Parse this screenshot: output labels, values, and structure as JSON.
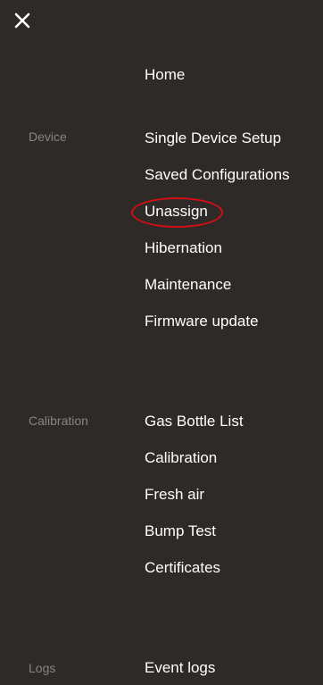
{
  "icons": {
    "close": "close-icon"
  },
  "colors": {
    "background": "#2e2a27",
    "menu_text": "#ffffff",
    "section_label": "#8a8481",
    "highlight": "#d40e14"
  },
  "menu": {
    "home": "Home",
    "device": {
      "label": "Device",
      "items": [
        "Single Device Setup",
        "Saved Configurations",
        "Unassign",
        "Hibernation",
        "Maintenance",
        "Firmware update"
      ]
    },
    "calibration": {
      "label": "Calibration",
      "items": [
        "Gas Bottle List",
        "Calibration",
        "Fresh air",
        "Bump Test",
        "Certificates"
      ]
    },
    "logs": {
      "label": "Logs",
      "items": [
        "Event logs"
      ]
    }
  }
}
